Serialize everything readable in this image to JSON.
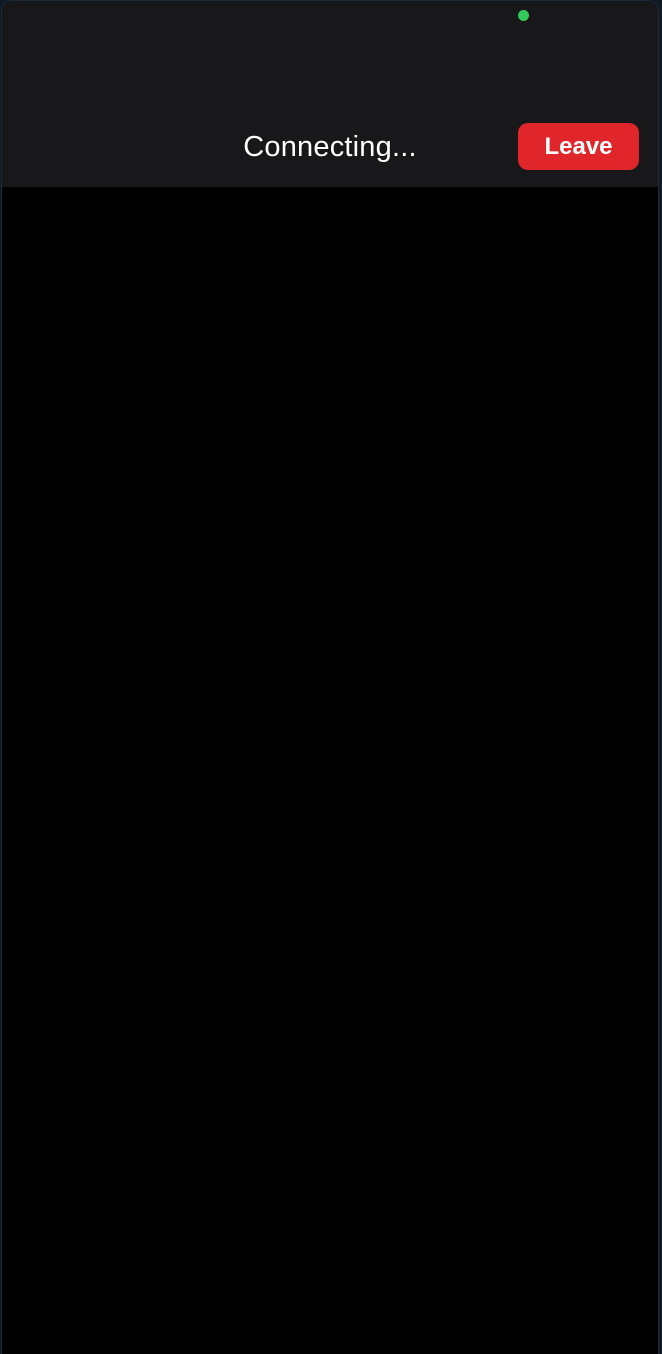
{
  "header": {
    "status_text": "Connecting...",
    "leave_label": "Leave"
  },
  "indicators": {
    "camera_icon": "green-dot-indicator"
  },
  "colors": {
    "header_bg": "#18181b",
    "video_bg": "#000000",
    "leave_button": "#e0262b",
    "indicator": "#34c759"
  }
}
